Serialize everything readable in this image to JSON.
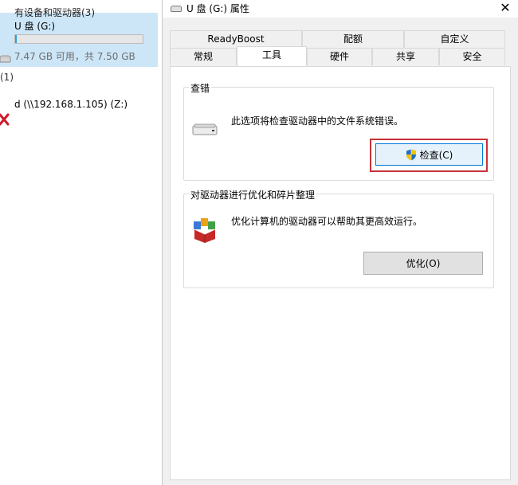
{
  "explorer": {
    "cut_title": "有设备和驱动器(3)",
    "drive": {
      "name": "U 盘 (G:)",
      "size_text": "7.47 GB 可用，共 7.50 GB",
      "used_fraction": 0.004
    },
    "group_count": "(1)",
    "network_drive": "d (\\\\192.168.1.105) (Z:)"
  },
  "dialog": {
    "title": "U 盘 (G:) 属性",
    "close_glyph": "✕",
    "tabs_row1": [
      "ReadyBoost",
      "配额",
      "自定义"
    ],
    "tabs_row2": [
      "常规",
      "工具",
      "硬件",
      "共享",
      "安全"
    ],
    "active_tab": "工具",
    "error_check": {
      "legend": "查错",
      "description": "此选项将检查驱动器中的文件系统错误。",
      "button": "检查(C)"
    },
    "optimize": {
      "legend": "对驱动器进行优化和碎片整理",
      "description": "优化计算机的驱动器可以帮助其更高效运行。",
      "button": "优化(O)"
    }
  },
  "colors": {
    "selection": "#cde6f7",
    "highlight_border": "#c8323c",
    "primary_button_border": "#0078d7"
  }
}
